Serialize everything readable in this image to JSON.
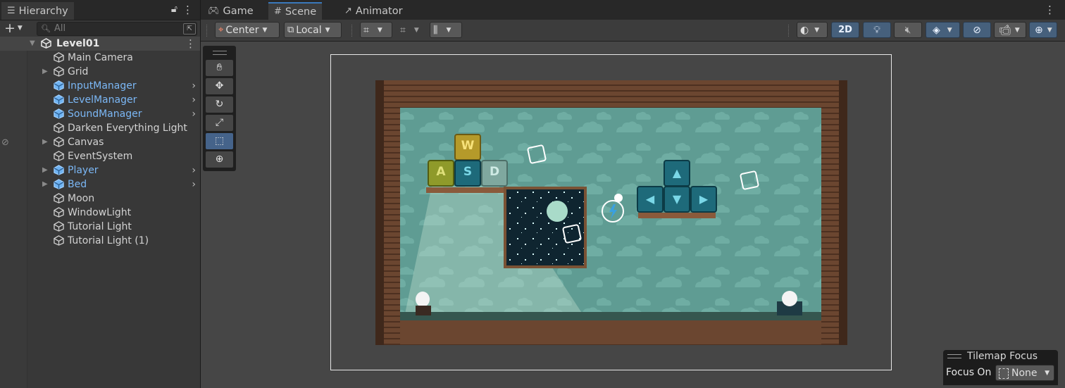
{
  "hierarchy": {
    "tab_label": "Hierarchy",
    "search_placeholder": "All",
    "root": "Level01",
    "items": [
      {
        "label": "Main Camera",
        "prefab": false,
        "expandable": false
      },
      {
        "label": "Grid",
        "prefab": false,
        "expandable": true
      },
      {
        "label": "InputManager",
        "prefab": true,
        "expandable": false
      },
      {
        "label": "LevelManager",
        "prefab": true,
        "expandable": false
      },
      {
        "label": "SoundManager",
        "prefab": true,
        "expandable": false
      },
      {
        "label": "Darken Everything Light",
        "prefab": false,
        "expandable": false
      },
      {
        "label": "Canvas",
        "prefab": false,
        "expandable": true
      },
      {
        "label": "EventSystem",
        "prefab": false,
        "expandable": false
      },
      {
        "label": "Player",
        "prefab": true,
        "expandable": true
      },
      {
        "label": "Bed",
        "prefab": true,
        "expandable": true
      },
      {
        "label": "Moon",
        "prefab": false,
        "expandable": false
      },
      {
        "label": "WindowLight",
        "prefab": false,
        "expandable": false
      },
      {
        "label": "Tutorial Light",
        "prefab": false,
        "expandable": false
      },
      {
        "label": "Tutorial Light (1)",
        "prefab": false,
        "expandable": false
      }
    ]
  },
  "tabs": {
    "game": "Game",
    "scene": "Scene",
    "animator": "Animator"
  },
  "toolbar": {
    "pivot": "Center",
    "space": "Local",
    "mode_2d": "2D"
  },
  "scene": {
    "keys": {
      "w": "W",
      "a": "A",
      "s": "S",
      "d": "D"
    },
    "tilemap_focus": {
      "title": "Tilemap Focus",
      "label": "Focus On",
      "value": "None"
    }
  },
  "colors": {
    "accent": "#3a79bb",
    "prefab": "#7bb7f5",
    "active_tool": "#45638a"
  }
}
